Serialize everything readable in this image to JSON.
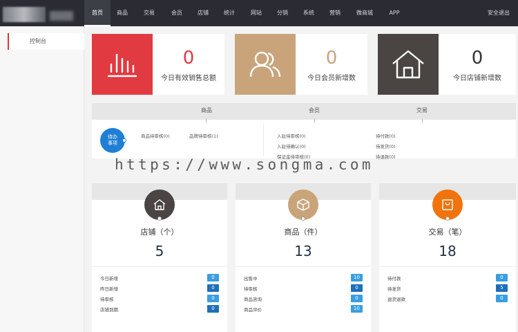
{
  "nav": {
    "items": [
      "首页",
      "商品",
      "交易",
      "会员",
      "店铺",
      "统计",
      "网站",
      "分销",
      "系统",
      "营销",
      "微商城",
      "APP"
    ],
    "logout": "安全退出"
  },
  "sidebar": {
    "items": [
      "控制台"
    ]
  },
  "stats": [
    {
      "value": "0",
      "label": "今日有效销售总额",
      "color": "#e23a41",
      "icon": "bar-chart-icon"
    },
    {
      "value": "0",
      "label": "今日会员新增数",
      "color": "#c9a47b",
      "icon": "users-icon"
    },
    {
      "value": "0",
      "label": "今日店铺新增数",
      "color": "#4a4543",
      "icon": "house-icon"
    }
  ],
  "pending": {
    "columns": [
      "商品",
      "会员",
      "交易"
    ],
    "todo_label_line1": "待办",
    "todo_label_line2": "事项",
    "goods_items": [
      "商品待审核(0)",
      "品牌待审核(1)"
    ],
    "member_items": [
      "入驻待审核(0)",
      "入驻待确认(0)",
      "保证金待审核(0)"
    ],
    "trade_items": [
      "待付款(0)",
      "待发货(0)",
      "待退款(0)"
    ]
  },
  "watermark": "https://www.songma.com",
  "panels": [
    {
      "title": "店铺（个）",
      "value": "5",
      "color": "#4a4543",
      "icon": "shop-icon",
      "rows": [
        {
          "label": "今日新增",
          "value": "0"
        },
        {
          "label": "昨日新增",
          "value": "0"
        },
        {
          "label": "待审核",
          "value": "0"
        },
        {
          "label": "店铺到期",
          "value": "0"
        }
      ]
    },
    {
      "title": "商品（件）",
      "value": "13",
      "color": "#c9a47b",
      "icon": "box-icon",
      "rows": [
        {
          "label": "出售中",
          "value": "10"
        },
        {
          "label": "待审核",
          "value": "0"
        },
        {
          "label": "商品咨询",
          "value": "0"
        },
        {
          "label": "商品评价",
          "value": "10"
        }
      ]
    },
    {
      "title": "交易（笔）",
      "value": "18",
      "color": "#f0730e",
      "icon": "bag-icon",
      "rows": [
        {
          "label": "待付款",
          "value": "0"
        },
        {
          "label": "待发货",
          "value": "5"
        },
        {
          "label": "退货退款",
          "value": "0"
        }
      ]
    }
  ]
}
